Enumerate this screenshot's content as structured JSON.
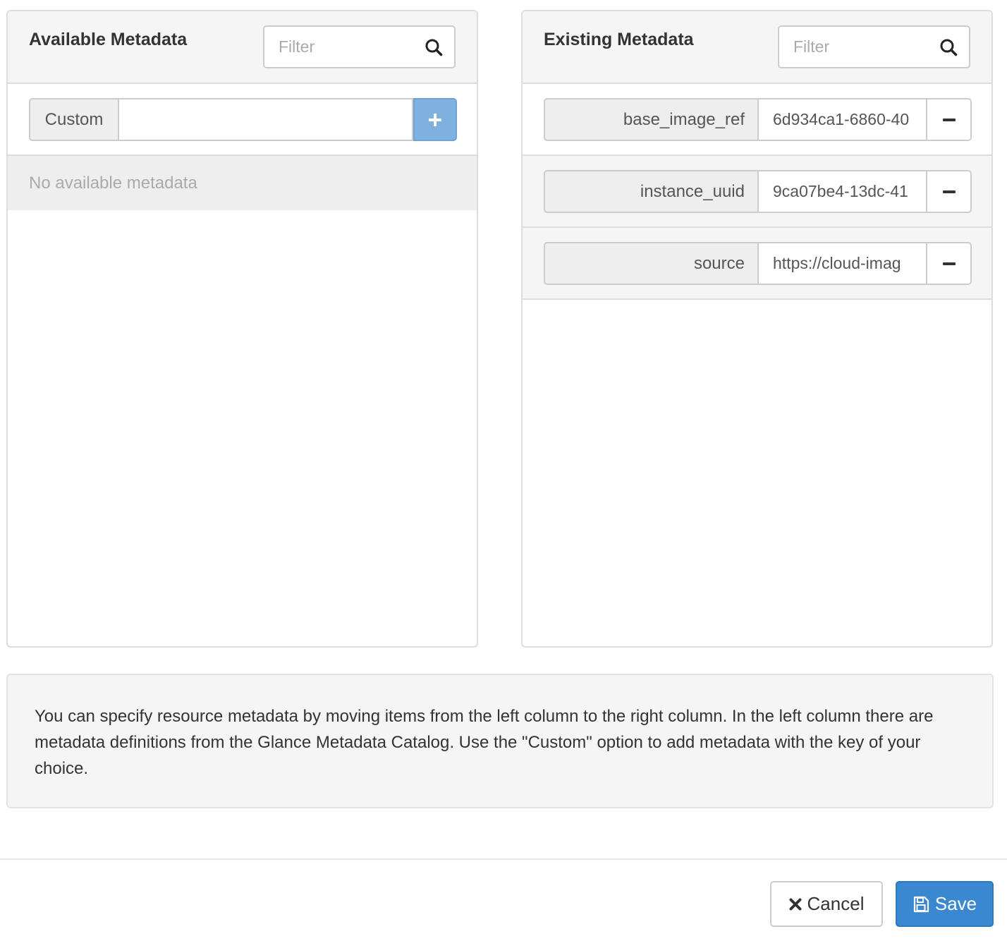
{
  "available": {
    "title": "Available Metadata",
    "filter_placeholder": "Filter",
    "custom_label": "Custom",
    "custom_value": "",
    "empty_text": "No available metadata"
  },
  "existing": {
    "title": "Existing Metadata",
    "filter_placeholder": "Filter",
    "items": [
      {
        "key": "base_image_ref",
        "value": "6d934ca1-6860-40"
      },
      {
        "key": "instance_uuid",
        "value": "9ca07be4-13dc-41"
      },
      {
        "key": "source",
        "value": "https://cloud-imag"
      }
    ]
  },
  "help": {
    "text": "You can specify resource metadata by moving items from the left column to the right column. In the left column there are metadata definitions from the Glance Metadata Catalog. Use the \"Custom\" option to add metadata with the key of your choice."
  },
  "footer": {
    "cancel_label": "Cancel",
    "save_label": "Save"
  },
  "icons": {
    "search": "search-icon",
    "add": "plus-icon",
    "remove": "minus-icon",
    "cancel": "times-icon",
    "save": "floppy-disk-icon"
  },
  "colors": {
    "primary": "#3a88d0",
    "add_button": "#7fb0e0"
  }
}
